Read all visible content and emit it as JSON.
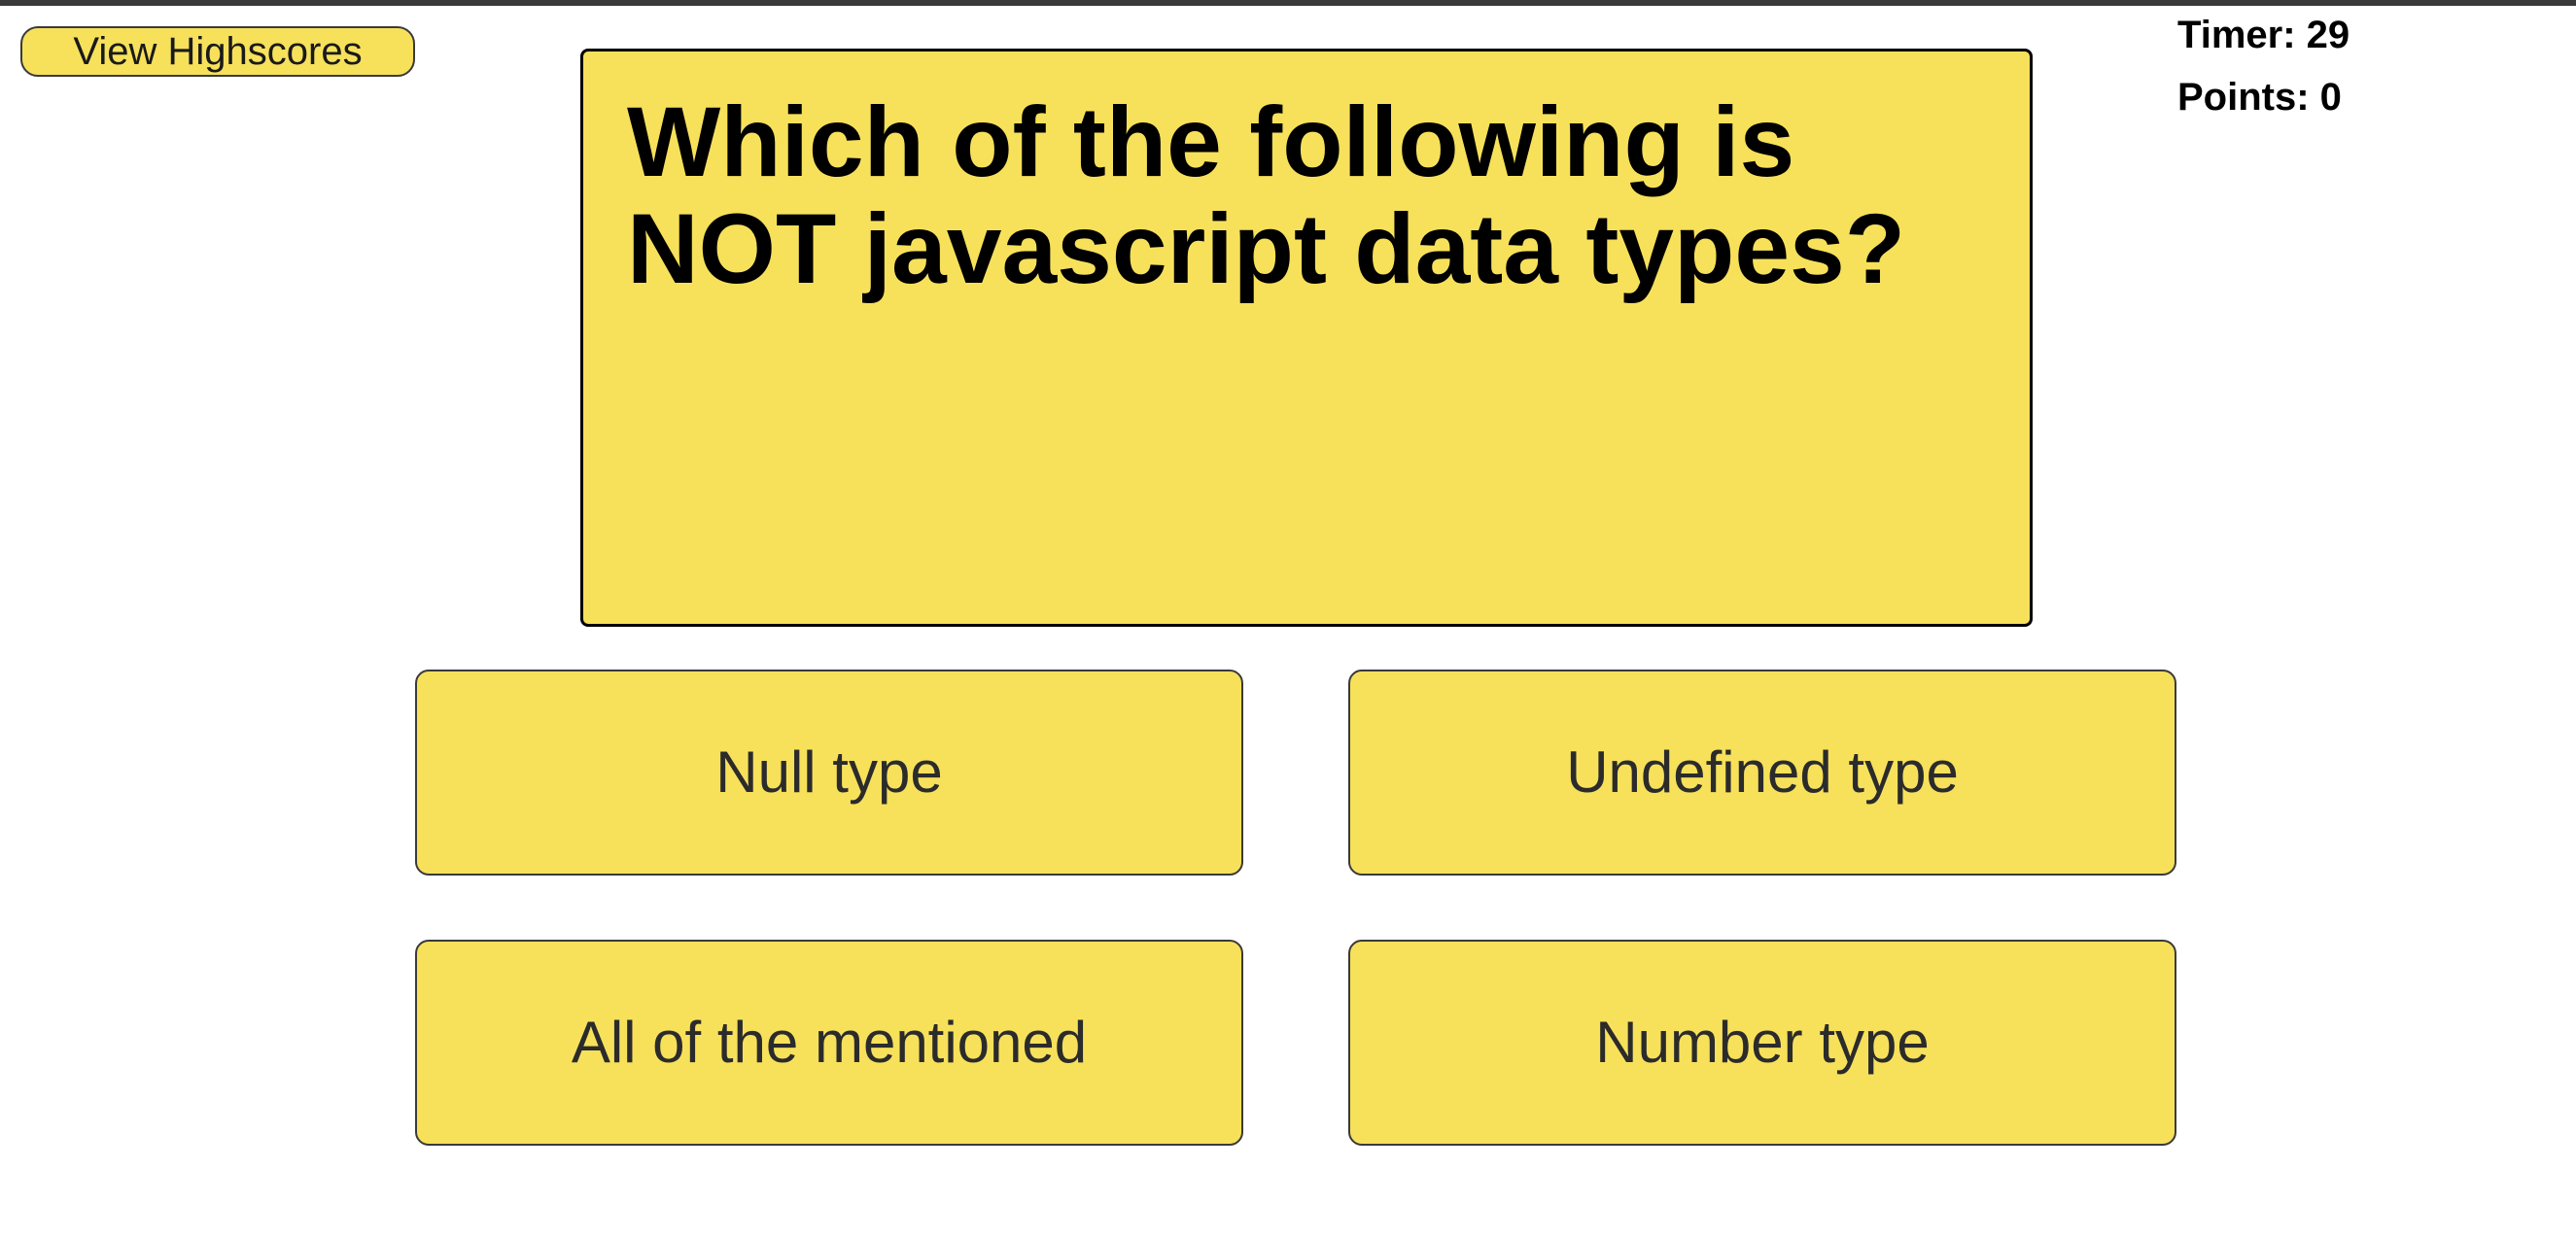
{
  "header": {
    "highscores_label": "View Highscores"
  },
  "stats": {
    "timer_label": "Timer: 29",
    "points_label": "Points: 0"
  },
  "question": {
    "text": "Which of the following is NOT javascript data types?"
  },
  "answers": [
    {
      "label": "Null type"
    },
    {
      "label": "Undefined type"
    },
    {
      "label": "All of the mentioned"
    },
    {
      "label": "Number type"
    }
  ],
  "colors": {
    "accent": "#f7e15b",
    "border": "#3a3a3a",
    "text": "#000000"
  }
}
